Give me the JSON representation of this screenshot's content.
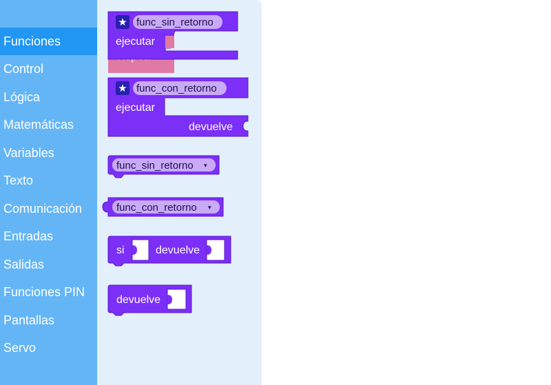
{
  "categories": [
    {
      "label": "Funciones",
      "selected": true
    },
    {
      "label": "Control",
      "selected": false
    },
    {
      "label": "Lógica",
      "selected": false
    },
    {
      "label": "Matemáticas",
      "selected": false
    },
    {
      "label": "Variables",
      "selected": false
    },
    {
      "label": "Texto",
      "selected": false
    },
    {
      "label": "Comunicación",
      "selected": false
    },
    {
      "label": "Entradas",
      "selected": false
    },
    {
      "label": "Salidas",
      "selected": false
    },
    {
      "label": "Funciones PIN",
      "selected": false
    },
    {
      "label": "Pantallas",
      "selected": false
    },
    {
      "label": "Servo",
      "selected": false
    }
  ],
  "blocks": {
    "def_no_return": {
      "name": "func_sin_retorno",
      "exec_label": "ejecutar",
      "behind_label": "Repetir"
    },
    "def_return": {
      "name": "func_con_retorno",
      "exec_label": "ejecutar",
      "return_label": "devuelve"
    },
    "call_no_return": {
      "name": "func_sin_retorno",
      "arrow": "▾"
    },
    "call_return": {
      "name": "func_con_retorno",
      "arrow": "▾"
    },
    "if_return": {
      "if_label": "si",
      "return_label": "devuelve"
    },
    "return": {
      "label": "devuelve"
    }
  },
  "colors": {
    "sidebar": "#64b5f6",
    "sidebar_selected": "#2196f3",
    "flyout": "#e3f0fb",
    "block": "#7b2ff7",
    "block_dark": "#5a1bc7",
    "field": "#c9aaf7",
    "star_badge": "#2b1fb0",
    "pink_block": "#e07aa5"
  },
  "icons": {
    "gear": "star-icon",
    "dropdown": "dropdown-arrow-icon"
  }
}
